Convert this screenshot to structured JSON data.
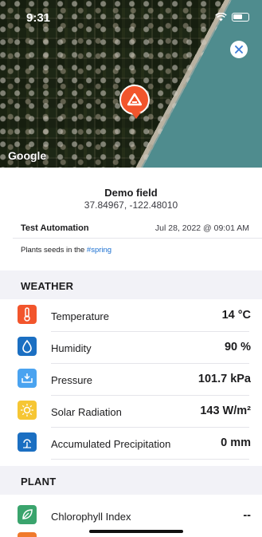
{
  "status_bar": {
    "time": "9:31"
  },
  "map": {
    "attribution": "Google",
    "pin_color": "#f2552c"
  },
  "field": {
    "name": "Demo field",
    "coordinates": "37.84967, -122.48010",
    "author": "Test Automation",
    "timestamp": "Jul 28, 2022 @ 09:01 AM",
    "note_text": "Plants seeds in the ",
    "note_tag": "#spring"
  },
  "weather": {
    "title": "WEATHER",
    "rows": [
      {
        "label": "Temperature",
        "value": "14 °C",
        "icon": "thermometer-icon",
        "color": "#f2552c"
      },
      {
        "label": "Humidity",
        "value": "90 %",
        "icon": "droplet-icon",
        "color": "#1b6fc2"
      },
      {
        "label": "Pressure",
        "value": "101.7 kPa",
        "icon": "pressure-icon",
        "color": "#4aa3f0"
      },
      {
        "label": "Solar Radiation",
        "value": "143 W/m²",
        "icon": "sun-icon",
        "color": "#f6c634"
      },
      {
        "label": "Accumulated Precipitation",
        "value": "0 mm",
        "icon": "rain-icon",
        "color": "#1b6fc2"
      }
    ]
  },
  "plant": {
    "title": "PLANT",
    "rows": [
      {
        "label": "Chlorophyll Index",
        "value": "--",
        "icon": "leaf-icon",
        "color": "#3aa46d"
      }
    ]
  }
}
